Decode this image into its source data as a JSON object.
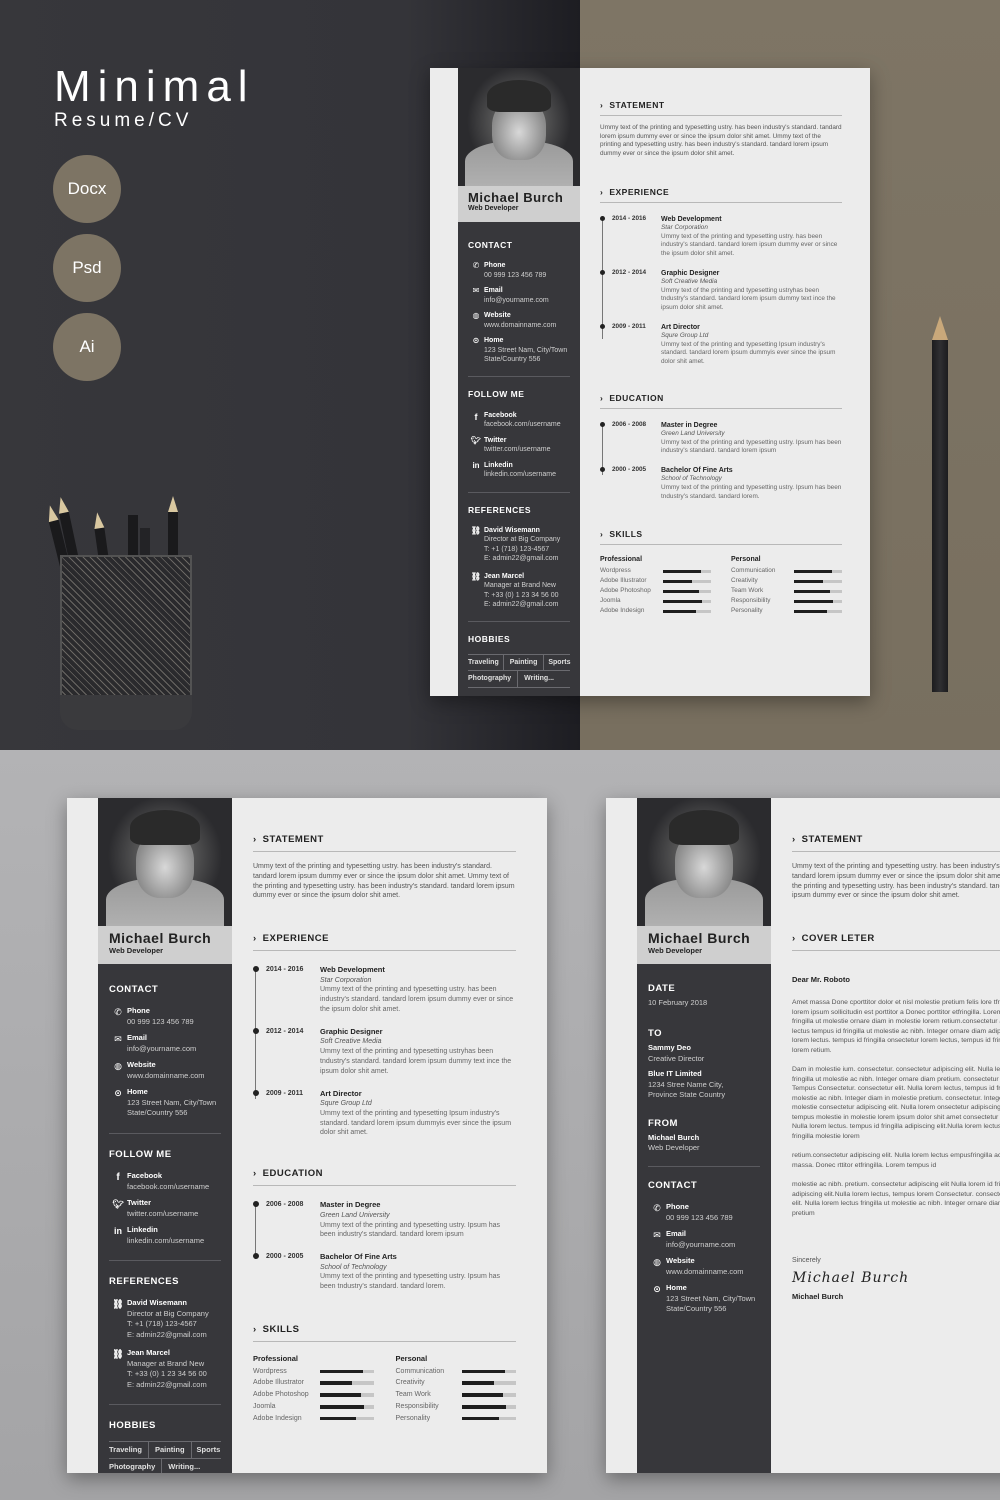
{
  "hero": {
    "title": "Minimal",
    "subtitle": "Resume/CV",
    "formats": [
      "Docx",
      "Psd",
      "Ai"
    ]
  },
  "colors": {
    "dark": "#37373b",
    "taupe": "#7d7464",
    "paper": "#ececec"
  },
  "resume": {
    "name": "Michael Burch",
    "role": "Web Developer",
    "contact_heading": "CONTACT",
    "contact": [
      {
        "icon": "phone-icon",
        "label": "Phone",
        "value": "00 999 123 456 789"
      },
      {
        "icon": "email-icon",
        "label": "Email",
        "value": "info@yourname.com"
      },
      {
        "icon": "globe-icon",
        "label": "Website",
        "value": "www.domainname.com"
      },
      {
        "icon": "location-pin-icon",
        "label": "Home",
        "value": "123 Street Nam, City/Town",
        "value2": "State/Country 556"
      }
    ],
    "follow_heading": "FOLLOW ME",
    "follow": [
      {
        "icon": "facebook-icon",
        "label": "Facebook",
        "value": "facebook.com/username"
      },
      {
        "icon": "twitter-icon",
        "label": "Twitter",
        "value": "twitter.com/username"
      },
      {
        "icon": "linkedin-icon",
        "label": "Linkedin",
        "value": "linkedin.com/username"
      }
    ],
    "references_heading": "REFERENCES",
    "references": [
      {
        "name": "David Wisemann",
        "title": "Director at Big Company",
        "phone": "T:  +1 (718) 123-4567",
        "email": "E: admin22@gmail.com"
      },
      {
        "name": "Jean Marcel",
        "title": "Manager at Brand New",
        "phone": "T: +33 (0) 1 23 34 56 00",
        "email": "E:  admin22@gmail.com"
      }
    ],
    "hobbies_heading": "HOBBIES",
    "hobbies_rows": [
      [
        "Traveling",
        "Painting",
        "Sports"
      ],
      [
        "Photography",
        "Writing..."
      ]
    ],
    "statement_heading": "STATEMENT",
    "statement": "Ummy text of the printing and typesetting ustry. has been industry's standard. tandard lorem ipsum dummy ever or since the ipsum dolor shit amet. Ummy text of the printing and typesetting ustry. has been industry's standard. tandard lorem ipsum dummy ever or since the ipsum dolor shit amet.",
    "experience_heading": "EXPERIENCE",
    "experience": [
      {
        "dates": "2014 - 2016",
        "title": "Web Development",
        "org": "Star Corporation",
        "desc": "Ummy text of the printing and typesetting ustry.  has been industry's standard. tandard lorem ipsum dummy ever or since the ipsum dolor shit amet."
      },
      {
        "dates": "2012 - 2014",
        "title": "Graphic Designer",
        "org": "Soft Creative Media",
        "desc": "Ummy text of the printing and typesetting ustryhas been tndustry's standard. tandard lorem ipsum dummy text ince the ipsum dolor shit amet."
      },
      {
        "dates": "2009 - 2011",
        "title": "Art Director",
        "org": "Squre Group Ltd",
        "desc": "Ummy text of the printing and typesetting  Ipsum industry's standard. tandard lorem ipsum dummyis ever since the ipsum dolor shit amet."
      }
    ],
    "education_heading": "EDUCATION",
    "education": [
      {
        "dates": "2006 - 2008",
        "title": "Master in Degree",
        "org": "Green Land University",
        "desc": "Ummy text of the printing and typesetting ustry. Ipsum has been industry's standard. tandard lorem ipsum"
      },
      {
        "dates": "2000 - 2005",
        "title": "Bachelor Of Fine Arts",
        "org": "School of Technology",
        "desc": "Ummy text of the printing and typesetting ustry. Ipsum has been tndustry's standard. tandard lorem."
      }
    ],
    "skills_heading": "SKILLS",
    "skills": {
      "professional_heading": "Professional",
      "professional": [
        {
          "name": "Wordpress",
          "level": 0.8
        },
        {
          "name": "Adobe Illustrator",
          "level": 0.6
        },
        {
          "name": "Adobe Photoshop",
          "level": 0.76
        },
        {
          "name": "Joomla",
          "level": 0.82
        },
        {
          "name": "Adobe Indesign",
          "level": 0.68
        }
      ],
      "personal_heading": "Personal",
      "personal": [
        {
          "name": "Communication",
          "level": 0.8
        },
        {
          "name": "Creativity",
          "level": 0.6
        },
        {
          "name": "Team Work",
          "level": 0.76
        },
        {
          "name": "Responsibility",
          "level": 0.82
        },
        {
          "name": "Personality",
          "level": 0.68
        }
      ]
    }
  },
  "cover": {
    "date_heading": "DATE",
    "date": "10 February 2018",
    "to_heading": "TO",
    "to_name": "Sammy Deo",
    "to_title": "Creative Director",
    "to_company": "Blue IT Limited",
    "to_addr1": "1234 Stree Name City,",
    "to_addr2": "Province State Country",
    "from_heading": "FROM",
    "from_name": "Michael Burch",
    "from_title": "Web Developer",
    "cover_heading": "COVER LETER",
    "salutation": "Dear Mr. Roboto",
    "paragraphs": [
      "Amet massa Done cporttitor dolor et nisl molestie pretium felis lore  tfringilla.  elislibero lorem ipsum sollicitudin est porttitor a Donec porttitor etfringilla. Lorem tempus id fringilla ut molestie ornare diam in molestie lorem retium.consectetur adipiscing elit lectus tempus id fringilla ut molestie ac nibh. Integer ornare diam adipiscing elit Nulla lorem lectus.  tempus id fringilla onsectetur lorem lectus, tempus id fringilla molestie lorem retium.",
      "Dam in molestie  ium. consectetur. consectetur adipiscing elit. Nulla lectus, tempus id fringilla ut molestie ac nibh. Integer ornare diam pretium. consectetur dipiscing elit. Tempus Consectetur. consectetur elit. Nulla lorem lectus, tempus id fringilla ut molestie ac nibh. Integer diam in molestie pretium. consectetur. Integer ornare diam in molestie consectetur adipiscing elit. Nulla lorem  onsectetur adipiscing elit lectus, tempus molestie in molestie lorem ipsum dolor shit amet consectetur adipiscing elit Nulla lorem lectus.  tempus id fringilla adipiscing elit.Nulla lorem lectus, tempus id fringilla molestie lorem",
      "retium.consectetur adipiscing elit. Nulla lorem lectus empusfringilla ac porttitor amet massa. Donec rttitor etfringilla. Lorem tempus id",
      "molestie ac nibh. pretium. consectetur adipiscing elit Nulla lorem id fringilla onsectetur adipiscing elit.Nulla lorem lectus, tempus lorem Consectetur. consectetur adipiscing elit. Nulla lorem lectus fringilla ut molestie ac nibh. Integer ornare diam in molestie pretium"
    ],
    "closing": "Sincerely",
    "signature": "Michael Burch",
    "signed_name": "Michael Burch"
  }
}
